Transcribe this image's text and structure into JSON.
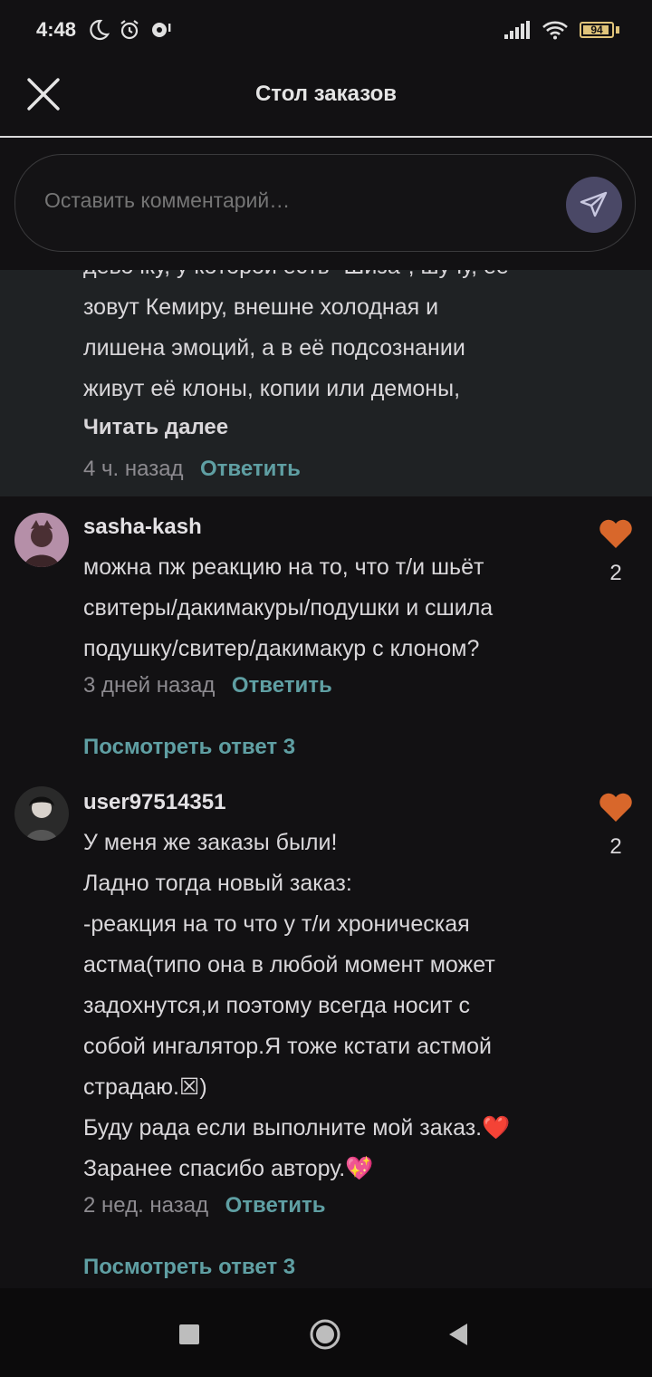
{
  "status": {
    "time": "4:48",
    "battery": "94",
    "battery_level": 0.94
  },
  "header": {
    "title": "Стол заказов"
  },
  "compose": {
    "placeholder": "Оставить комментарий…"
  },
  "top_comment": {
    "lines": [
      "девочку, у которой есть \"Шиза\", шучу, её",
      "зовут Кемиру, внешне холодная и",
      "лишена эмоций, а в её подсознании",
      "живут её клоны, копии или демоны,"
    ],
    "read_more": "Читать далее",
    "time": "4 ч. назад",
    "reply": "Ответить"
  },
  "comments": [
    {
      "username": "sasha-kash",
      "lines": [
        "можна пж реакцию на то, что т/и шьёт",
        "свитеры/дакимакуры/подушки и сшила",
        "подушку/свитер/дакимакур с клоном?"
      ],
      "time": "3 дней назад",
      "reply": "Ответить",
      "likes": "2",
      "view_replies": "Посмотреть ответ 3"
    },
    {
      "username": "user97514351",
      "lines": [
        "У меня же заказы были!",
        "Ладно тогда новый заказ:",
        "-реакция на то что у т/и хроническая",
        "астма(типо она в любой момент может",
        "задохнутся,и поэтому всегда носит с",
        "собой ингалятор.Я тоже кстати астмой",
        "страдаю.☒)",
        "Буду рада если выполните мой заказ.❤️",
        "Заранее спасибо автору.💖"
      ],
      "time": "2 нед. назад",
      "reply": "Ответить",
      "likes": "2",
      "view_replies": "Посмотреть ответ 3"
    }
  ],
  "colors": {
    "accent": "#5f9fa3",
    "heart": "#d8672b",
    "background": "#121113",
    "highlight": "#1f2224"
  }
}
